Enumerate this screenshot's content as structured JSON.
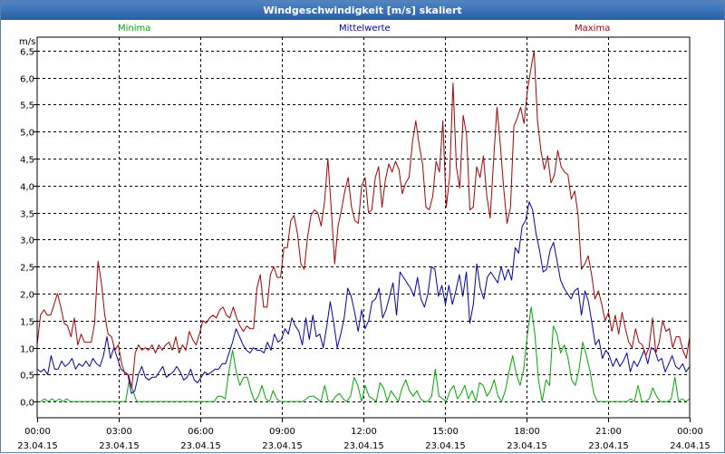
{
  "title": "Windgeschwindigkeit [m/s] skaliert",
  "chart_data": {
    "type": "line",
    "title": "Windgeschwindigkeit [m/s] skaliert",
    "ylabel": "m/s",
    "xlabel": "",
    "ylim": [
      -0.3,
      6.75
    ],
    "xlim_hours": [
      0,
      24
    ],
    "grid": true,
    "legend_position": "top",
    "y_ticks": [
      "0,0",
      "0,5",
      "1,0",
      "1,5",
      "2,0",
      "2,5",
      "3,0",
      "3,5",
      "4,0",
      "4,5",
      "5,0",
      "5,5",
      "6,0",
      "6,5"
    ],
    "x_ticks": [
      {
        "time": "00:00",
        "date": "23.04.15"
      },
      {
        "time": "03:00",
        "date": "23.04.15"
      },
      {
        "time": "06:00",
        "date": "23.04.15"
      },
      {
        "time": "09:00",
        "date": "23.04.15"
      },
      {
        "time": "12:00",
        "date": "23.04.15"
      },
      {
        "time": "15:00",
        "date": "23.04.15"
      },
      {
        "time": "18:00",
        "date": "23.04.15"
      },
      {
        "time": "21:00",
        "date": "23.04.15"
      },
      {
        "time": "00:00",
        "date": "24.04.15"
      }
    ],
    "series": [
      {
        "name": "Minima",
        "color": "#00aa00",
        "values": [
          0,
          0,
          0.05,
          0,
          0.05,
          0,
          0.05,
          0,
          0.05,
          0,
          0,
          0,
          0,
          0,
          0,
          0,
          0,
          0,
          0,
          0,
          0,
          0,
          0,
          0,
          0,
          0.4,
          0.2,
          0,
          0,
          0,
          0,
          0,
          0,
          0,
          0,
          0,
          0,
          0,
          0,
          0,
          0,
          0,
          0,
          0,
          0,
          0,
          0,
          0,
          0,
          0.1,
          0.1,
          0.05,
          0.55,
          0.95,
          0.55,
          0.3,
          0.45,
          0.45,
          0.2,
          0,
          0.1,
          0.3,
          0.05,
          0,
          0.2,
          0.05,
          0,
          0,
          0,
          0,
          0,
          0,
          0,
          0.05,
          0.1,
          0.1,
          0.05,
          0,
          0.3,
          0,
          0,
          0.1,
          0.15,
          0.05,
          0,
          0.1,
          0.45,
          0.3,
          0,
          0.3,
          0.1,
          0.05,
          0,
          0.35,
          0.25,
          0,
          0.2,
          0.1,
          0,
          0.25,
          0.4,
          0.2,
          0.1,
          0.2,
          0.05,
          0,
          0,
          0.1,
          0.6,
          0.1,
          0.05,
          0,
          0.2,
          0.3,
          0.05,
          0.15,
          0.3,
          0.05,
          0.2,
          0,
          0.35,
          0.3,
          0.1,
          0.2,
          0.4,
          0.1,
          0,
          0.2,
          0.55,
          0.85,
          0.5,
          0.3,
          0.6,
          1.25,
          1.75,
          1.25,
          0.4,
          0,
          0.4,
          0.3,
          1.4,
          1.25,
          0.9,
          1.05,
          0.8,
          0.4,
          0.3,
          0.6,
          1.1,
          0.85,
          0.55,
          0.15,
          0,
          0,
          0,
          0,
          0,
          0,
          0,
          0,
          0,
          0.05,
          0,
          0.3,
          0,
          0,
          0.05,
          0.25,
          0.1,
          0,
          0,
          0,
          0.05,
          0.45,
          0,
          0.05,
          0,
          0.05
        ]
      },
      {
        "name": "Mittelwerte",
        "color": "#0000aa",
        "values": [
          0.6,
          0.55,
          0.6,
          0.5,
          0.85,
          0.6,
          0.6,
          0.75,
          0.65,
          0.7,
          0.8,
          0.6,
          0.7,
          0.65,
          0.75,
          0.65,
          0.8,
          0.7,
          0.65,
          0.85,
          1.2,
          0.8,
          1.0,
          0.8,
          0.6,
          0.55,
          0.5,
          0.15,
          0.2,
          0.5,
          0.65,
          0.45,
          0.4,
          0.45,
          0.45,
          0.55,
          0.65,
          0.45,
          0.5,
          0.55,
          0.65,
          0.55,
          0.4,
          0.45,
          0.6,
          0.4,
          0.35,
          0.45,
          0.55,
          0.5,
          0.55,
          0.6,
          0.6,
          0.7,
          0.7,
          0.9,
          1.1,
          1.35,
          1.2,
          1.05,
          0.95,
          0.9,
          1.0,
          0.95,
          0.95,
          0.9,
          1.1,
          0.95,
          1.25,
          1.1,
          1.15,
          1.35,
          1.25,
          1.55,
          1.4,
          1.3,
          1.05,
          1.55,
          1.15,
          1.6,
          1.2,
          1.25,
          1.0,
          1.4,
          1.85,
          1.45,
          1.0,
          1.25,
          1.55,
          2.1,
          1.95,
          1.65,
          1.3,
          1.7,
          1.35,
          1.5,
          1.85,
          1.9,
          2.1,
          1.55,
          1.7,
          1.95,
          2.2,
          1.6,
          2.4,
          2.3,
          2.2,
          2.1,
          1.95,
          2.3,
          1.9,
          1.75,
          2.0,
          2.5,
          2.45,
          1.95,
          2.15,
          1.8,
          2.15,
          1.8,
          2.05,
          2.35,
          1.95,
          2.4,
          1.45,
          1.8,
          2.55,
          2.1,
          1.9,
          2.3,
          2.4,
          2.3,
          2.2,
          2.5,
          2.25,
          2.45,
          2.25,
          2.85,
          2.75,
          3.25,
          3.35,
          3.7,
          3.55,
          3.1,
          2.8,
          2.4,
          2.45,
          2.8,
          2.95,
          2.6,
          2.25,
          2.1,
          2.0,
          1.9,
          2.05,
          2.1,
          1.6,
          2.05,
          1.85,
          1.45,
          1.05,
          1.15,
          0.8,
          0.95,
          0.85,
          0.65,
          0.8,
          0.65,
          0.75,
          0.9,
          0.55,
          0.75,
          0.65,
          0.8,
          0.95,
          0.7,
          1.0,
          0.95,
          0.75,
          0.8,
          0.55,
          0.7,
          0.85,
          0.65,
          0.6,
          0.7,
          0.55,
          0.65
        ]
      },
      {
        "name": "Maxima",
        "color": "#aa0000",
        "values": [
          1.05,
          1.6,
          1.7,
          1.6,
          1.6,
          1.8,
          2.0,
          1.75,
          1.45,
          1.4,
          1.2,
          1.55,
          1.05,
          1.25,
          1.1,
          1.1,
          1.1,
          1.45,
          2.6,
          2.2,
          1.6,
          1.25,
          1.2,
          0.95,
          1.05,
          0.7,
          0.5,
          0.5,
          0.25,
          0.9,
          1.05,
          0.95,
          1.0,
          0.95,
          1.05,
          0.9,
          1.05,
          0.95,
          1.05,
          1.1,
          0.95,
          1.2,
          0.9,
          1.05,
          0.95,
          1.3,
          1.15,
          1.05,
          1.25,
          1.5,
          1.45,
          1.55,
          1.6,
          1.55,
          1.7,
          1.75,
          1.6,
          1.55,
          1.75,
          1.55,
          1.4,
          1.3,
          1.4,
          1.35,
          1.35,
          2.1,
          2.35,
          1.75,
          1.75,
          2.35,
          2.5,
          2.3,
          2.3,
          2.85,
          2.85,
          3.35,
          3.45,
          3.1,
          2.55,
          2.45,
          3.05,
          3.45,
          3.55,
          3.5,
          3.25,
          3.7,
          4.5,
          3.55,
          2.55,
          3.25,
          3.55,
          3.9,
          4.15,
          3.6,
          3.35,
          3.3,
          4.0,
          4.15,
          3.5,
          3.55,
          4.15,
          4.35,
          3.6,
          4.1,
          4.4,
          4.25,
          4.45,
          4.3,
          3.85,
          4.05,
          4.15,
          4.8,
          5.2,
          4.75,
          4.4,
          3.6,
          3.55,
          3.8,
          4.45,
          4.25,
          5.2,
          3.6,
          4.15,
          5.9,
          4.35,
          3.95,
          5.3,
          4.95,
          3.55,
          3.6,
          4.35,
          4.15,
          4.55,
          3.8,
          3.4,
          4.45,
          5.45,
          4.75,
          3.95,
          3.3,
          3.6,
          5.1,
          5.25,
          5.45,
          5.15,
          5.75,
          6.15,
          6.5,
          5.2,
          4.65,
          4.3,
          4.55,
          4.05,
          4.2,
          4.65,
          4.35,
          4.25,
          4.2,
          3.75,
          3.9,
          3.45,
          2.45,
          2.55,
          2.7,
          2.35,
          1.9,
          2.05,
          1.8,
          1.5,
          1.65,
          1.3,
          1.6,
          1.25,
          1.65,
          1.35,
          1.1,
          1.0,
          1.35,
          1.1,
          1.05,
          0.85,
          1.0,
          1.55,
          0.9,
          1.1,
          1.5,
          1.3,
          1.35,
          1.0,
          1.2,
          1.2,
          0.95,
          0.8,
          1.2
        ]
      }
    ]
  }
}
